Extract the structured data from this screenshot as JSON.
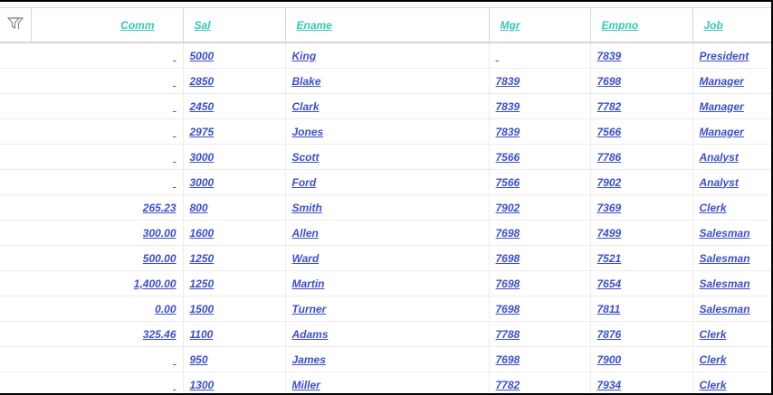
{
  "header": {
    "filter_icon": "filter-icon",
    "columns": [
      "Comm",
      "Sal",
      "Ename",
      "Mgr",
      "Empno",
      "Job"
    ]
  },
  "colors": {
    "header_link": "#2ecdb4",
    "cell_link": "#3b4ed6"
  },
  "rows": [
    {
      "comm": "",
      "sal": "5000",
      "ename": "King",
      "mgr": "",
      "empno": "7839",
      "job": "President"
    },
    {
      "comm": "",
      "sal": "2850",
      "ename": "Blake",
      "mgr": "7839",
      "empno": "7698",
      "job": "Manager"
    },
    {
      "comm": "",
      "sal": "2450",
      "ename": "Clark",
      "mgr": "7839",
      "empno": "7782",
      "job": "Manager"
    },
    {
      "comm": "",
      "sal": "2975",
      "ename": "Jones",
      "mgr": "7839",
      "empno": "7566",
      "job": "Manager"
    },
    {
      "comm": "",
      "sal": "3000",
      "ename": "Scott",
      "mgr": "7566",
      "empno": "7786",
      "job": "Analyst"
    },
    {
      "comm": "",
      "sal": "3000",
      "ename": "Ford",
      "mgr": "7566",
      "empno": "7902",
      "job": "Analyst"
    },
    {
      "comm": "265.23",
      "sal": "800",
      "ename": "Smith",
      "mgr": "7902",
      "empno": "7369",
      "job": "Clerk"
    },
    {
      "comm": "300.00",
      "sal": "1600",
      "ename": "Allen",
      "mgr": "7698",
      "empno": "7499",
      "job": "Salesman"
    },
    {
      "comm": "500.00",
      "sal": "1250",
      "ename": "Ward",
      "mgr": "7698",
      "empno": "7521",
      "job": "Salesman"
    },
    {
      "comm": "1,400.00",
      "sal": "1250",
      "ename": "Martin",
      "mgr": "7698",
      "empno": "7654",
      "job": "Salesman"
    },
    {
      "comm": "0.00",
      "sal": "1500",
      "ename": "Turner",
      "mgr": "7698",
      "empno": "7811",
      "job": "Salesman"
    },
    {
      "comm": "325.46",
      "sal": "1100",
      "ename": "Adams",
      "mgr": "7788",
      "empno": "7876",
      "job": "Clerk"
    },
    {
      "comm": "",
      "sal": "950",
      "ename": "James",
      "mgr": "7698",
      "empno": "7900",
      "job": "Clerk"
    },
    {
      "comm": "",
      "sal": "1300",
      "ename": "Miller",
      "mgr": "7782",
      "empno": "7934",
      "job": "Clerk"
    }
  ]
}
